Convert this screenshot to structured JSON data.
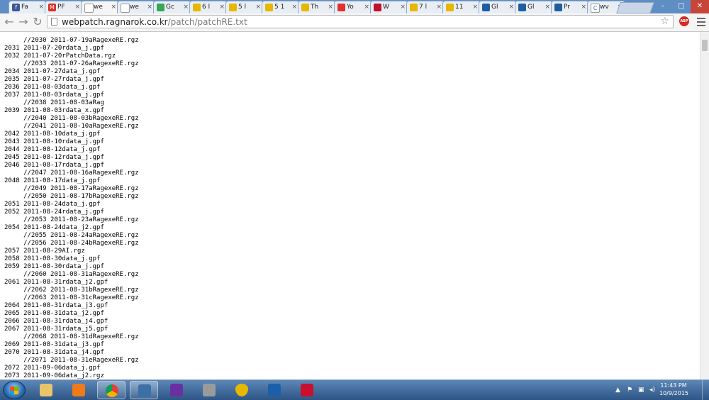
{
  "browser": {
    "tabs": [
      {
        "title": "Fa",
        "favicon": "facebook-icon",
        "color": "#3b5998",
        "glyph": "f"
      },
      {
        "title": "PF",
        "favicon": "gmail-icon",
        "color": "#d93025",
        "glyph": "M"
      },
      {
        "title": "we",
        "favicon": "page-icon",
        "color": "#ffffff",
        "glyph": "",
        "active": true
      },
      {
        "title": "we",
        "favicon": "page-icon",
        "color": "#ffffff",
        "glyph": ""
      },
      {
        "title": "Gc",
        "favicon": "google-maps-icon",
        "color": "#34a853",
        "glyph": ""
      },
      {
        "title": "6 l",
        "favicon": "ragnarok-coin-icon",
        "color": "#e8b700",
        "glyph": ""
      },
      {
        "title": "5 l",
        "favicon": "ragnarok-coin-icon",
        "color": "#e8b700",
        "glyph": ""
      },
      {
        "title": "5 1",
        "favicon": "ragnarok-coin-icon",
        "color": "#e8b700",
        "glyph": ""
      },
      {
        "title": "Th",
        "favicon": "ragnarok-coin-icon",
        "color": "#e8b700",
        "glyph": ""
      },
      {
        "title": "Yo",
        "favicon": "poring-icon",
        "color": "#e03030",
        "glyph": ""
      },
      {
        "title": "W",
        "favicon": "lips-icon",
        "color": "#c0102a",
        "glyph": ""
      },
      {
        "title": "7 l",
        "favicon": "ragnarok-coin-icon",
        "color": "#e8b700",
        "glyph": ""
      },
      {
        "title": "11",
        "favicon": "ragnarok-coin-icon",
        "color": "#e8b700",
        "glyph": ""
      },
      {
        "title": "Gl",
        "favicon": "glyph-icon",
        "color": "#1f5f9f",
        "glyph": ""
      },
      {
        "title": "Gl",
        "favicon": "glyph-icon",
        "color": "#1f5f9f",
        "glyph": ""
      },
      {
        "title": "Pr",
        "favicon": "glyph-icon",
        "color": "#1f5f9f",
        "glyph": ""
      },
      {
        "title": "wv",
        "favicon": "c-icon",
        "color": "#ffffff",
        "glyph": "C"
      }
    ],
    "url_host": "webpatch.ragnarok.co.kr",
    "url_path": "/patch/patchRE.txt",
    "abp_label": "ABP"
  },
  "file_lines": [
    "     //2030 2011-07-19aRagexeRE.rgz",
    "2031 2011-07-20rdata_j.gpf",
    "2032 2011-07-20rPatchData.rgz",
    "     //2033 2011-07-26aRagexeRE.rgz",
    "2034 2011-07-27data_j.gpf",
    "2035 2011-07-27rdata_j.gpf",
    "2036 2011-08-03data_j.gpf",
    "2037 2011-08-03rdata_j.gpf",
    "     //2038 2011-08-03aRag",
    "2039 2011-08-03rdata_x.gpf",
    "     //2040 2011-08-03bRagexeRE.rgz",
    "     //2041 2011-08-10aRagexeRE.rgz",
    "2042 2011-08-10data_j.gpf",
    "2043 2011-08-10rdata_j.gpf",
    "2044 2011-08-12data_j.gpf",
    "2045 2011-08-12rdata_j.gpf",
    "2046 2011-08-17rdata_j.gpf",
    "     //2047 2011-08-16aRagexeRE.rgz",
    "2048 2011-08-17data_j.gpf",
    "     //2049 2011-08-17aRagexeRE.rgz",
    "     //2050 2011-08-17bRagexeRE.rgz",
    "2051 2011-08-24data_j.gpf",
    "2052 2011-08-24rdata_j.gpf",
    "     //2053 2011-08-23aRagexeRE.rgz",
    "2054 2011-08-24data_j2.gpf",
    "     //2055 2011-08-24aRagexeRE.rgz",
    "     //2056 2011-08-24bRagexeRE.rgz",
    "2057 2011-08-29AI.rgz",
    "2058 2011-08-30data_j.gpf",
    "2059 2011-08-30rdata_j.gpf",
    "     //2060 2011-08-31aRagexeRE.rgz",
    "2061 2011-08-31rdata_j2.gpf",
    "     //2062 2011-08-31bRagexeRE.rgz",
    "     //2063 2011-08-31cRagexeRE.rgz",
    "2064 2011-08-31rdata_j3.gpf",
    "2065 2011-08-31data_j2.gpf",
    "2066 2011-08-31rdata_j4.gpf",
    "2067 2011-08-31rdata_j5.gpf",
    "     //2068 2011-08-31dRagexeRE.rgz",
    "2069 2011-08-31data_j3.gpf",
    "2070 2011-08-31data_j4.gpf",
    "     //2071 2011-08-31eRagexeRE.rgz",
    "2072 2011-09-06data_j.gpf",
    "2073 2011-09-06data_j2.rgz"
  ],
  "taskbar": {
    "pinned": [
      {
        "name": "file-explorer-icon",
        "color": "#e9c46a",
        "open": false
      },
      {
        "name": "media-player-icon",
        "color": "#f07a1a",
        "open": false
      },
      {
        "name": "chrome-icon",
        "color": "#2f9e44",
        "open": true
      },
      {
        "name": "gamepad-app-icon",
        "color": "#3c6fa6",
        "open": true
      },
      {
        "name": "w-app-icon",
        "color": "#6a2fa0",
        "open": false
      },
      {
        "name": "calendar-app-icon",
        "color": "#9a9a9a",
        "open": false
      },
      {
        "name": "coin-app-icon",
        "color": "#e8b700",
        "open": false
      },
      {
        "name": "spiral-app-icon",
        "color": "#1c5fa8",
        "open": false
      },
      {
        "name": "acrobat-icon",
        "color": "#c8102e",
        "open": false
      }
    ],
    "time": "11:43 PM",
    "date": "10/9/2015"
  }
}
